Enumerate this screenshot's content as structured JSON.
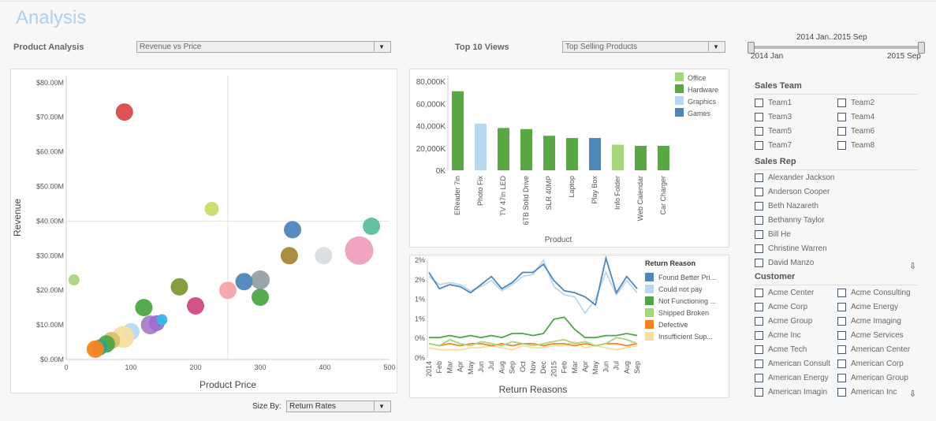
{
  "header": {
    "title": "Analysis"
  },
  "product_analysis": {
    "label": "Product Analysis",
    "dropdown_value": "Revenue vs Price",
    "size_by_label": "Size By:",
    "size_by_value": "Return Rates"
  },
  "top_views": {
    "label": "Top 10 Views",
    "dropdown_value": "Top Selling Products"
  },
  "date_slider": {
    "range_label": "2014 Jan..2015 Sep",
    "start_label": "2014 Jan",
    "end_label": "2015 Sep"
  },
  "filters": {
    "sales_team": {
      "title": "Sales Team",
      "items": [
        "Team1",
        "Team2",
        "Team3",
        "Team4",
        "Team5",
        "Team6",
        "Team7",
        "Team8"
      ]
    },
    "sales_rep": {
      "title": "Sales Rep",
      "items": [
        "Alexander Jackson",
        "Anderson Cooper",
        "Beth Nazareth",
        "Bethanny Taylor",
        "Bill He",
        "Christine Warren",
        "David Manzo"
      ]
    },
    "customer": {
      "title": "Customer",
      "items": [
        "Acme Center",
        "Acme Consulting",
        "Acme Corp",
        "Acme Energy",
        "Acme Group",
        "Acme Imaging",
        "Acme Inc",
        "Acme Services",
        "Acme Tech",
        "American Center",
        "American Consult",
        "American Corp",
        "American Energy",
        "American Group",
        "American Imagin",
        "American Inc"
      ]
    }
  },
  "chart_data": [
    {
      "type": "scatter",
      "xlabel": "Product Price",
      "ylabel": "Revenue",
      "xlim": [
        0,
        500
      ],
      "ylim": [
        0,
        82
      ],
      "x_ticks": [
        "0",
        "100",
        "200",
        "300",
        "400",
        "500"
      ],
      "y_ticks": [
        "$0.00M",
        "$10.00M",
        "$20.00M",
        "$30.00M",
        "$40.00M",
        "$50.00M",
        "$60.00M",
        "$70.00M",
        "$80.00M"
      ],
      "reference_lines": {
        "x": 250,
        "y": 40
      },
      "points": [
        {
          "x": 90,
          "y": 71.5,
          "size": 11,
          "color": "#d94a4a"
        },
        {
          "x": 225,
          "y": 43.5,
          "size": 9,
          "color": "#c8dc6a"
        },
        {
          "x": 12,
          "y": 23,
          "size": 7,
          "color": "#a6d67b"
        },
        {
          "x": 350,
          "y": 37.5,
          "size": 11,
          "color": "#4f86b8"
        },
        {
          "x": 472,
          "y": 38.5,
          "size": 11,
          "color": "#5bbf9a"
        },
        {
          "x": 453,
          "y": 31.5,
          "size": 18,
          "color": "#ee9fbf"
        },
        {
          "x": 345,
          "y": 30,
          "size": 11,
          "color": "#a88838"
        },
        {
          "x": 398,
          "y": 30,
          "size": 11,
          "color": "#d8dde0"
        },
        {
          "x": 300,
          "y": 23,
          "size": 12,
          "color": "#959fa6"
        },
        {
          "x": 275,
          "y": 22.5,
          "size": 11,
          "color": "#4f86b8"
        },
        {
          "x": 250,
          "y": 20,
          "size": 11,
          "color": "#f4a6a6"
        },
        {
          "x": 300,
          "y": 18,
          "size": 11,
          "color": "#4fa547"
        },
        {
          "x": 175,
          "y": 21,
          "size": 11,
          "color": "#7e9a34"
        },
        {
          "x": 200,
          "y": 15.5,
          "size": 11,
          "color": "#d04a7e"
        },
        {
          "x": 120,
          "y": 15,
          "size": 11,
          "color": "#4fa547"
        },
        {
          "x": 130,
          "y": 10,
          "size": 12,
          "color": "#a87ec8"
        },
        {
          "x": 140,
          "y": 10.5,
          "size": 10,
          "color": "#9c6ed0"
        },
        {
          "x": 148,
          "y": 11.5,
          "size": 7,
          "color": "#36b8e6"
        },
        {
          "x": 100,
          "y": 8,
          "size": 11,
          "color": "#b8d8f0"
        },
        {
          "x": 88,
          "y": 6.5,
          "size": 14,
          "color": "#f8dea0"
        },
        {
          "x": 70,
          "y": 5.5,
          "size": 11,
          "color": "#d8c070"
        },
        {
          "x": 62,
          "y": 4.5,
          "size": 11,
          "color": "#4fa547"
        },
        {
          "x": 52,
          "y": 3.5,
          "size": 10,
          "color": "#2ea58c"
        },
        {
          "x": 45,
          "y": 3,
          "size": 11,
          "color": "#f5841f"
        }
      ]
    },
    {
      "type": "bar",
      "xlabel": "Product",
      "categories": [
        "EReader 7in",
        "Photo Fix",
        "TV 47in LED",
        "6TB Solid Drive",
        "SLR 40MP",
        "Laptop",
        "Play Box",
        "Info Folder",
        "Web Calendar",
        "Car Charger"
      ],
      "values": [
        71000,
        42000,
        38000,
        37000,
        31000,
        29000,
        29000,
        23000,
        22000,
        22000
      ],
      "category_group": [
        "Hardware",
        "Graphics",
        "Hardware",
        "Hardware",
        "Hardware",
        "Hardware",
        "Games",
        "Office",
        "Hardware",
        "Hardware"
      ],
      "y_ticks": [
        "0K",
        "20,000K",
        "40,000K",
        "60,000K",
        "80,000K"
      ],
      "ylim": [
        0,
        85000
      ],
      "legend": [
        {
          "name": "Office",
          "color": "#a6d67b"
        },
        {
          "name": "Hardware",
          "color": "#5aa843"
        },
        {
          "name": "Graphics",
          "color": "#b8d8f0"
        },
        {
          "name": "Games",
          "color": "#4f86b8"
        }
      ]
    },
    {
      "type": "line",
      "xlabel": "Return Reasons",
      "legend_title": "Return Reason",
      "x": [
        "2014",
        "Feb",
        "Mar",
        "Apr",
        "May",
        "Jun",
        "Jul",
        "Aug",
        "Sep",
        "Oct",
        "Nov",
        "Dec",
        "2015",
        "Feb",
        "Mar",
        "Apr",
        "May",
        "Jun",
        "Jul",
        "Aug",
        "Sep"
      ],
      "y_ticks": [
        "0%",
        "0%",
        "1%",
        "1%",
        "2%",
        "2%"
      ],
      "ylim": [
        0,
        2.4
      ],
      "series": [
        {
          "name": "Found Better Pri...",
          "color": "#4f86b8",
          "values": [
            2.1,
            1.7,
            1.8,
            1.75,
            1.6,
            1.8,
            2.0,
            1.7,
            1.85,
            2.1,
            2.1,
            2.3,
            1.9,
            1.65,
            1.6,
            1.5,
            1.3,
            2.45,
            1.6,
            2.0,
            1.7
          ]
        },
        {
          "name": "Could not pay",
          "color": "#b8d8f0",
          "values": [
            2.0,
            1.8,
            1.85,
            1.8,
            1.65,
            1.75,
            1.9,
            1.65,
            1.8,
            2.0,
            2.05,
            2.4,
            1.75,
            1.55,
            1.5,
            1.1,
            1.45,
            2.1,
            1.55,
            1.9,
            1.6
          ]
        },
        {
          "name": "Not Functioning ...",
          "color": "#4fa547",
          "values": [
            0.5,
            0.5,
            0.55,
            0.5,
            0.55,
            0.5,
            0.55,
            0.5,
            0.6,
            0.6,
            0.55,
            0.6,
            0.95,
            1.0,
            0.7,
            0.5,
            0.5,
            0.55,
            0.55,
            0.6,
            0.55
          ]
        },
        {
          "name": "Shipped Broken",
          "color": "#a6d67b",
          "values": [
            0.35,
            0.3,
            0.45,
            0.35,
            0.3,
            0.4,
            0.35,
            0.3,
            0.4,
            0.35,
            0.3,
            0.35,
            0.4,
            0.45,
            0.35,
            0.4,
            0.3,
            0.35,
            0.5,
            0.45,
            0.35
          ]
        },
        {
          "name": "Defective",
          "color": "#f5841f",
          "values": [
            0.35,
            0.3,
            0.35,
            0.3,
            0.35,
            0.35,
            0.3,
            0.35,
            0.3,
            0.35,
            0.35,
            0.3,
            0.35,
            0.35,
            0.3,
            0.35,
            0.3,
            0.35,
            0.35,
            0.3,
            0.35
          ]
        },
        {
          "name": "Insufficient Sup...",
          "color": "#f8dea0",
          "values": [
            0.25,
            0.2,
            0.2,
            0.2,
            0.25,
            0.25,
            0.3,
            0.25,
            0.2,
            0.3,
            0.25,
            0.25,
            0.3,
            0.3,
            0.4,
            0.25,
            0.3,
            0.25,
            0.2,
            0.25,
            0.3
          ]
        }
      ]
    }
  ]
}
